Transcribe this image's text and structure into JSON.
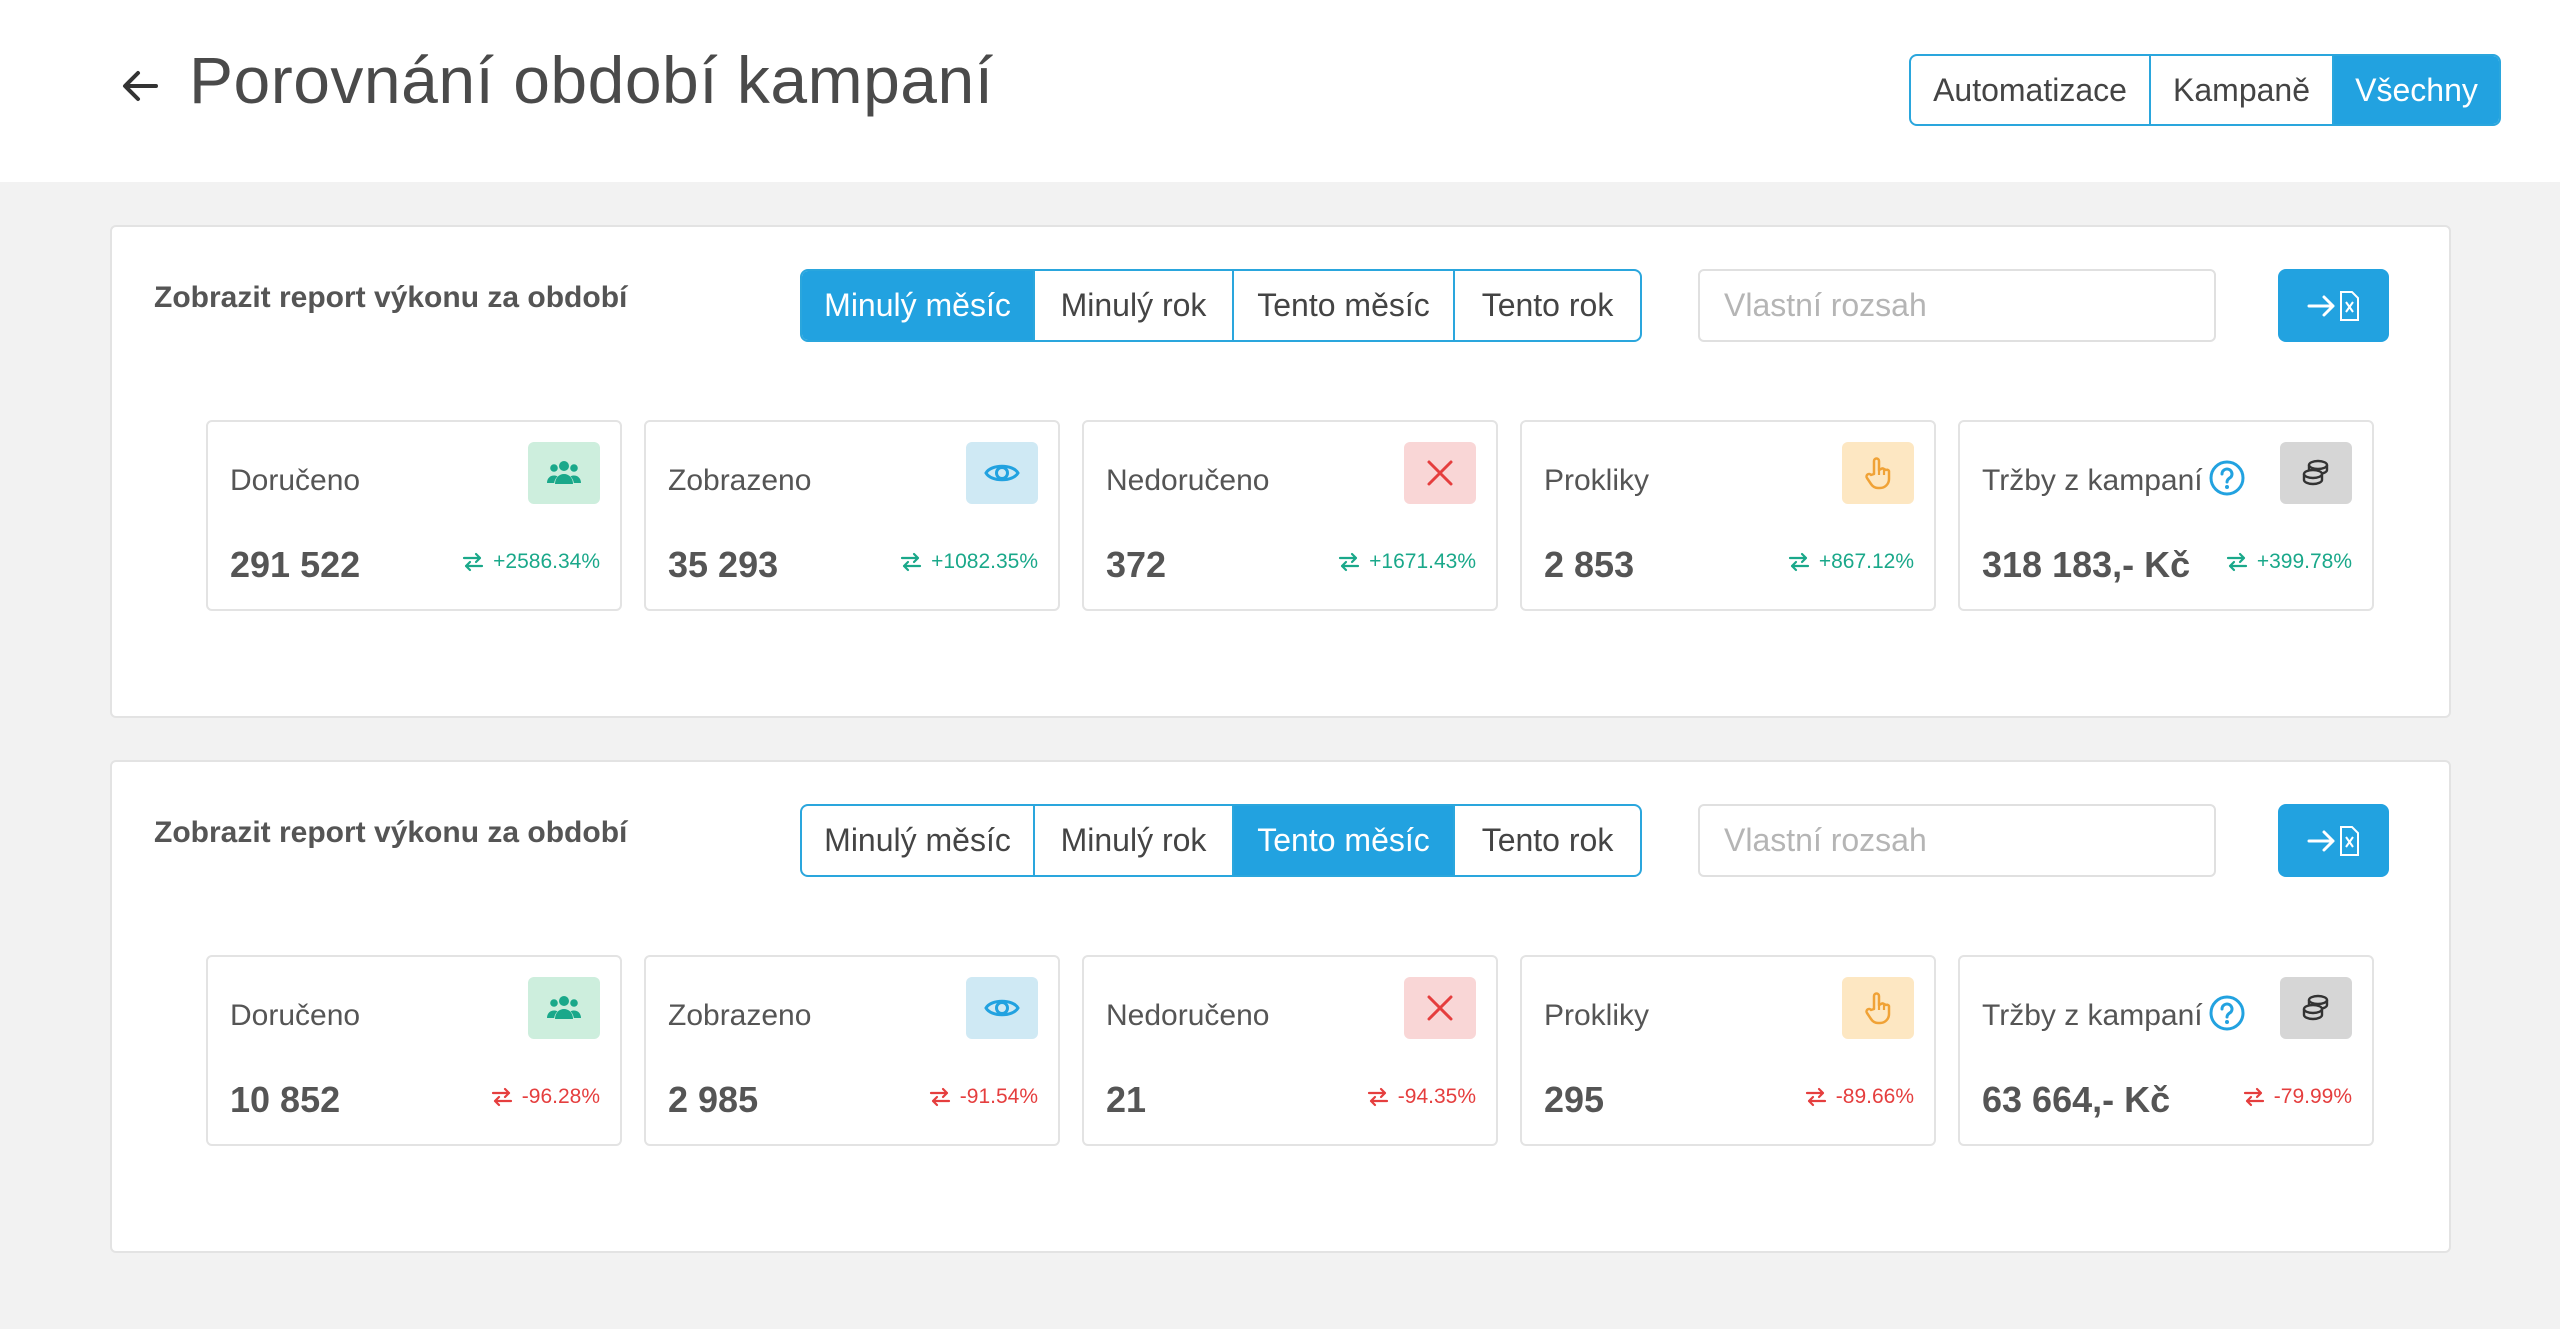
{
  "header": {
    "title": "Porovnání období kampaní",
    "filters": [
      "Automatizace",
      "Kampaně",
      "Všechny"
    ],
    "active_filter": 2
  },
  "colors": {
    "accent": "#22a2e0",
    "positive": "#1aa88a",
    "negative": "#e53e3e"
  },
  "panels": [
    {
      "label": "Zobrazit report výkonu za období",
      "periods": [
        "Minulý měsíc",
        "Minulý rok",
        "Tento měsíc",
        "Tento rok"
      ],
      "active_period": 0,
      "custom_placeholder": "Vlastní rozsah",
      "cards": [
        {
          "label": "Doručeno",
          "value": "291 522",
          "change": "+2586.34%",
          "icon": "users-icon"
        },
        {
          "label": "Zobrazeno",
          "value": "35 293",
          "change": "+1082.35%",
          "icon": "eye-icon"
        },
        {
          "label": "Nedoručeno",
          "value": "372",
          "change": "+1671.43%",
          "icon": "close-icon"
        },
        {
          "label": "Prokliky",
          "value": "2 853",
          "change": "+867.12%",
          "icon": "pointer-hand-icon"
        },
        {
          "label": "Tržby z kampaní",
          "value": "318 183,- Kč",
          "change": "+399.78%",
          "icon": "coins-icon"
        }
      ]
    },
    {
      "label": "Zobrazit report výkonu za období",
      "periods": [
        "Minulý měsíc",
        "Minulý rok",
        "Tento měsíc",
        "Tento rok"
      ],
      "active_period": 2,
      "custom_placeholder": "Vlastní rozsah",
      "cards": [
        {
          "label": "Doručeno",
          "value": "10 852",
          "change": "-96.28%",
          "icon": "users-icon"
        },
        {
          "label": "Zobrazeno",
          "value": "2 985",
          "change": "-91.54%",
          "icon": "eye-icon"
        },
        {
          "label": "Nedoručeno",
          "value": "21",
          "change": "-94.35%",
          "icon": "close-icon"
        },
        {
          "label": "Prokliky",
          "value": "295",
          "change": "-89.66%",
          "icon": "pointer-hand-icon"
        },
        {
          "label": "Tržby z kampaní",
          "value": "63 664,- Kč",
          "change": "-79.99%",
          "icon": "coins-icon"
        }
      ]
    }
  ]
}
